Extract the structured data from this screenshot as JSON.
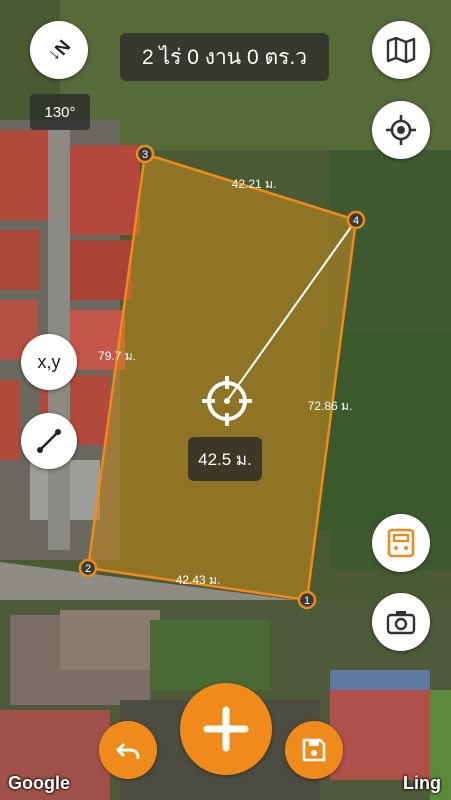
{
  "header": {
    "area_text": "2 ไร่ 0 งาน 0 ตร.ว"
  },
  "compass": {
    "label": "N"
  },
  "bearing": {
    "text": "130°"
  },
  "plot": {
    "vertices": [
      {
        "label": "1"
      },
      {
        "label": "2"
      },
      {
        "label": "3"
      },
      {
        "label": "4"
      }
    ],
    "edges": [
      {
        "text": "42.21 ม."
      },
      {
        "text": "72.86 ม."
      },
      {
        "text": "42.43 ม."
      },
      {
        "text": "79.7 ม."
      }
    ],
    "measure_text": "42.5 ม."
  },
  "buttons": {
    "xy_label": "x,y"
  },
  "attribution": {
    "left": "Google",
    "right": "Ling"
  },
  "colors": {
    "accent": "#f08a1a",
    "plot_fill": "#c98a1d",
    "vertex_fill": "#3a3a3a"
  }
}
